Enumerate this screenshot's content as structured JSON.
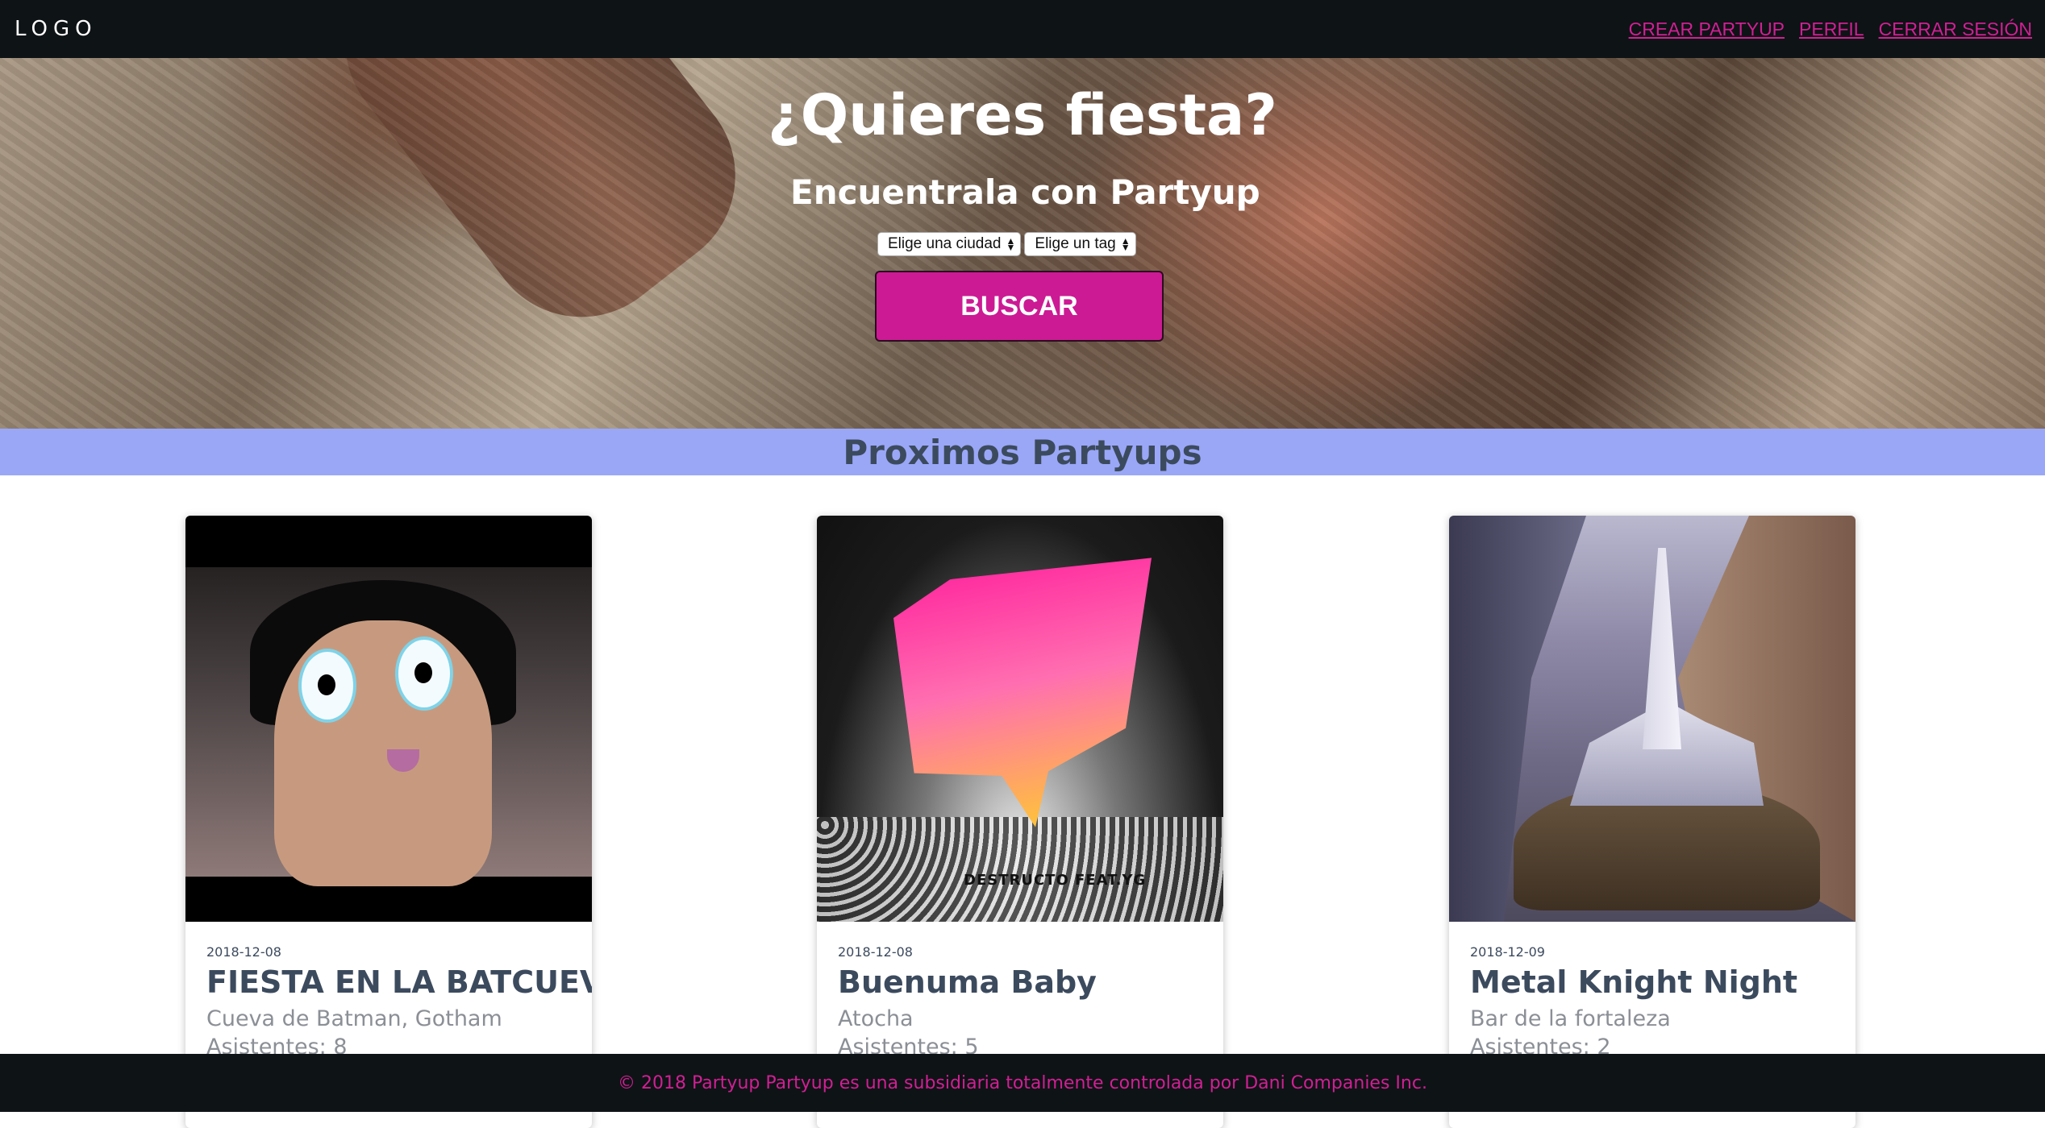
{
  "navbar": {
    "logo": "LOGO",
    "links": [
      "CREAR PARTYUP",
      "PERFIL",
      "CERRAR SESIÓN"
    ]
  },
  "hero": {
    "title": "¿Quieres fiesta?",
    "subtitle": "Encuentrala con Partyup",
    "city_select": "Elige una ciudad",
    "tag_select": "Elige un tag",
    "search_button": "BUSCAR"
  },
  "section": {
    "title": "Proximos Partyups"
  },
  "cards": [
    {
      "date": "2018-12-08",
      "title": "FIESTA EN LA BATCUEVA",
      "location": "Cueva de Batman, Gotham",
      "attendees": "Asistentes: 8",
      "image": "cartoon-owl-image"
    },
    {
      "date": "2018-12-08",
      "title": "Buenuma Baby",
      "location": "Atocha",
      "attendees": "Asistentes: 5",
      "image": "party-poster-image",
      "image_caption": "DESTRUCTO FEAT.YG"
    },
    {
      "date": "2018-12-09",
      "title": "Metal Knight Night",
      "location": "Bar de la fortaleza",
      "attendees": "Asistentes: 2",
      "image": "fortress-painting-image"
    }
  ],
  "footer": {
    "text": "© 2018 Partyup Partyup es una subsidiaria totalmente controlada por Dani Companies Inc."
  },
  "colors": {
    "accent": "#cc1a94",
    "nav_bg": "#0e1316",
    "band_bg": "#9aa7f7",
    "heading": "#3c4a5e"
  }
}
